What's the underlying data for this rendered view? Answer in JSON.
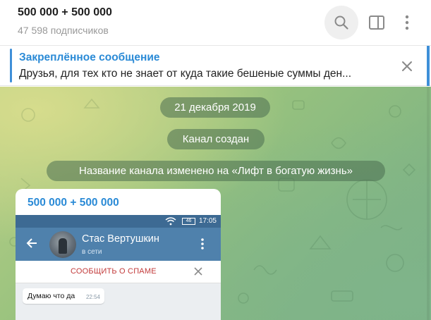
{
  "header": {
    "title": "500 000 + 500 000",
    "subscribers": "47 598 подписчиков",
    "icons": [
      "search-icon",
      "sidebar-toggle-icon",
      "more-vertical-icon"
    ]
  },
  "pinned": {
    "title": "Закреплённое сообщение",
    "text": "Друзья, для тех кто не знает от куда такие бешеные суммы ден..."
  },
  "chat": {
    "date": "21 декабря 2019",
    "service_created": "Канал создан",
    "service_renamed": "Название канала изменено на «Лифт в богатую жизнь»"
  },
  "message": {
    "sender": "500 000 + 500 000",
    "screenshot": {
      "time": "17:05",
      "battery": "46",
      "contact_name": "Стас Вертушкин",
      "contact_status": "в сети",
      "report_spam": "СООБЩИТЬ О СПАМЕ",
      "inner_message": "Думаю что да",
      "inner_time": "22:54"
    }
  },
  "colors": {
    "accent": "#2a8ad6",
    "service_pill": "#4b6e50",
    "tg_header": "#4f81ac"
  }
}
